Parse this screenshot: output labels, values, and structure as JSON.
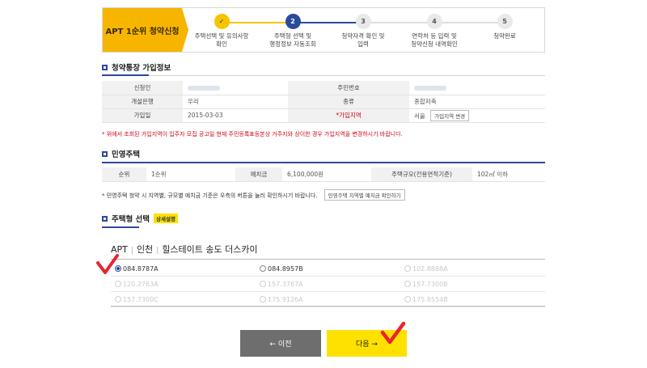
{
  "stepper": {
    "title": "APT 1순위 청약신청",
    "steps": [
      {
        "num": "✓",
        "label1": "주택선택 및 유의사항",
        "label2": "확인"
      },
      {
        "num": "2",
        "label1": "주택형 선택 및",
        "label2": "행정정보 자동조회"
      },
      {
        "num": "3",
        "label1": "청약자격 확인 및",
        "label2": "입력"
      },
      {
        "num": "4",
        "label1": "연락처 등 입력 및",
        "label2": "청약신청 내역확인"
      },
      {
        "num": "5",
        "label1": "청약완료",
        "label2": ""
      }
    ]
  },
  "account": {
    "title": "청약통장 가입정보",
    "applicant_label": "신청인",
    "resident_no_label": "주민번호",
    "bank_label": "개설은행",
    "bank_value": "우리",
    "type_label": "종류",
    "type_value": "종합저축",
    "join_date_label": "가입일",
    "join_date_value": "2015-03-03",
    "region_label": "*가입지역",
    "region_value": "서울",
    "region_change_btn": "가입지역 변경",
    "note": "* 위에서 조회된 가입지역이 입주자 모집 공고일 현재 주민등록표등본상 거주지와 상이한 경우 가입지역을 변경하시기 바랍니다."
  },
  "private_housing": {
    "title": "민영주택",
    "rank_label": "순위",
    "rank_value": "1순위",
    "deposit_label": "예치금",
    "deposit_value": "6,100,000원",
    "size_label": "주택규모(전용면적기준)",
    "size_value": "102㎡ 이하",
    "note": "* 민영주택 청약 시 지역별, 규모별 예치금 기준은 우측의 버튼을 눌러 확인하시기 바랍니다.",
    "check_btn": "민영주택 지역별 예치금 확인하기"
  },
  "house_type": {
    "title": "주택형 선택",
    "detail_badge": "상세설명",
    "apt": "APT",
    "region": "인천",
    "complex": "힐스테이트 송도 더스카이",
    "options": [
      {
        "label": "084.8787A",
        "enabled": true,
        "selected": true
      },
      {
        "label": "084.8957B",
        "enabled": true,
        "selected": false
      },
      {
        "label": "102.8888A",
        "enabled": false,
        "selected": false
      },
      {
        "label": "120.2763A",
        "enabled": false,
        "selected": false
      },
      {
        "label": "157.3767A",
        "enabled": false,
        "selected": false
      },
      {
        "label": "157.7300B",
        "enabled": false,
        "selected": false
      },
      {
        "label": "157.7300C",
        "enabled": false,
        "selected": false
      },
      {
        "label": "175.9126A",
        "enabled": false,
        "selected": false
      },
      {
        "label": "175.8554B",
        "enabled": false,
        "selected": false
      }
    ]
  },
  "nav": {
    "prev": "← 이전",
    "next": "다음 →"
  },
  "colors": {
    "accent_yellow": "#f7b500",
    "primary_blue": "#2c4a9a",
    "annotation_red": "#e8242f"
  }
}
